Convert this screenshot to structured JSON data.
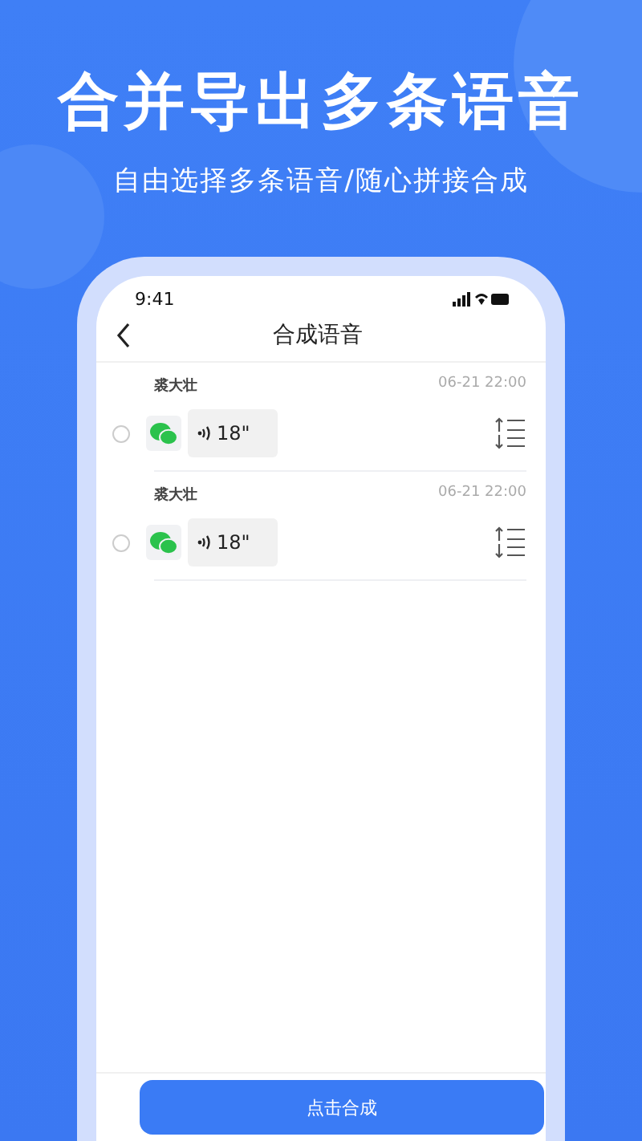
{
  "headline": "合并导出多条语音",
  "subtitle": "自由选择多条语音/随心拼接合成",
  "phone": {
    "status_time": "9:41",
    "title": "合成语音",
    "items": [
      {
        "sender": "裘大壮",
        "time": "06-21 22:00",
        "duration": "18\"",
        "selected": false
      },
      {
        "sender": "裘大壮",
        "time": "06-21 22:00",
        "duration": "18\"",
        "selected": false
      }
    ],
    "action_button": "点击合成"
  }
}
